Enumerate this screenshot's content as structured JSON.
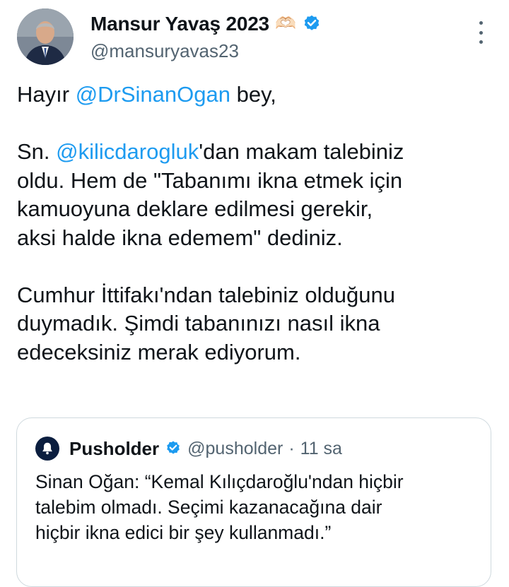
{
  "author": {
    "display_name": "Mansur Yavaş 2023",
    "emoji": "🫶🏻",
    "handle": "@mansuryavas23",
    "avatar_icon": "profile-photo",
    "verified_icon": "verified-badge-icon"
  },
  "tweet": {
    "p1_before": "Hayır ",
    "p1_mention": "@DrSinanOgan",
    "p1_after": " bey,",
    "p2_before": "Sn. ",
    "p2_mention": "@kilicdarogluk",
    "p2_after": "'dan makam talebiniz\noldu. Hem de \"Tabanımı ikna etmek için\nkamuoyuna deklare edilmesi gerekir,\naksi halde ikna edemem\" dediniz.",
    "p3": "Cumhur İttifakı'ndan talebiniz olduğunu\nduymadık. Şimdi tabanınızı nasıl ikna\nedeceksiniz merak ediyorum."
  },
  "quote": {
    "name": "Pusholder",
    "handle": "@pusholder",
    "separator": "·",
    "time": "11 sa",
    "text": "Sinan Oğan: “Kemal Kılıçdaroğlu'ndan hiçbir\ntalebim olmadı. Seçimi kazanacağına dair\nhiçbir ikna edici bir şey kullanmadı.”"
  },
  "colors": {
    "accent": "#1d9bf0",
    "secondary_text": "#536471",
    "border": "#cfd9de"
  }
}
